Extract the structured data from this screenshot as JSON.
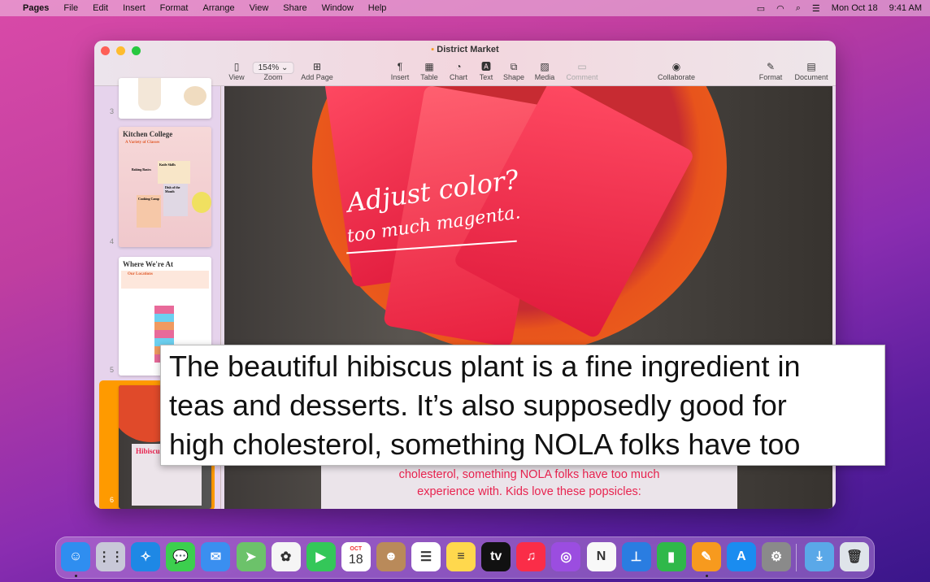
{
  "menubar": {
    "apple": "",
    "items": [
      "Pages",
      "File",
      "Edit",
      "Insert",
      "Format",
      "Arrange",
      "View",
      "Share",
      "Window",
      "Help"
    ],
    "date": "Mon Oct 18",
    "time": "9:41 AM"
  },
  "window": {
    "title": "District Market"
  },
  "toolbar": {
    "zoom_value": "154%",
    "items": [
      {
        "label": "View",
        "icon": "sidebar-icon",
        "glyph": "▯"
      },
      {
        "label": "Zoom",
        "icon": "zoom-select"
      },
      {
        "label": "Add Page",
        "icon": "add-page-icon",
        "glyph": "⊞"
      },
      {
        "label": "Insert",
        "icon": "pilcrow-icon",
        "glyph": "¶"
      },
      {
        "label": "Table",
        "icon": "table-icon",
        "glyph": "▦"
      },
      {
        "label": "Chart",
        "icon": "chart-icon",
        "glyph": "◔"
      },
      {
        "label": "Text",
        "icon": "text-icon",
        "glyph": "🅰"
      },
      {
        "label": "Shape",
        "icon": "shape-icon",
        "glyph": "⧉"
      },
      {
        "label": "Media",
        "icon": "media-icon",
        "glyph": "▨"
      },
      {
        "label": "Comment",
        "icon": "comment-icon",
        "glyph": "▭",
        "disabled": true
      },
      {
        "label": "Collaborate",
        "icon": "collaborate-icon",
        "glyph": "◉"
      },
      {
        "label": "Format",
        "icon": "format-brush-icon",
        "glyph": "✎"
      },
      {
        "label": "Document",
        "icon": "document-icon",
        "glyph": "▤"
      }
    ]
  },
  "sidebar": {
    "pages": [
      {
        "num": "3"
      },
      {
        "num": "4",
        "title": "Kitchen College",
        "subtitle": "A Variety of Classes",
        "boxes": [
          "Baking Basics",
          "Knife Skills",
          "Dish of the Month",
          "Cooking Camp"
        ]
      },
      {
        "num": "5",
        "title": "Where We're At",
        "subtitle": "Our Locations"
      },
      {
        "num": "6",
        "title": "Hibiscus",
        "selected": true
      }
    ]
  },
  "canvas": {
    "annotation_line1": "Adjust color?",
    "annotation_line2": "too much magenta.",
    "body_lines": [
      "cholesterol, something NOLA folks have too much",
      "experience with. Kids love these popsicles:"
    ],
    "text_color": "#e8234f"
  },
  "hover_text": {
    "lines": [
      "The beautiful hibiscus plant is a fine ingredient in",
      "teas and desserts. It’s also supposedly good for",
      "high cholesterol, something NOLA folks have too"
    ]
  },
  "dock": {
    "apps": [
      {
        "name": "Finder",
        "color": "#2f8ef0",
        "glyph": "☺",
        "running": true
      },
      {
        "name": "Launchpad",
        "color": "#c8c8d8",
        "glyph": "⋮⋮"
      },
      {
        "name": "Safari",
        "color": "#1e88e5",
        "glyph": "✧"
      },
      {
        "name": "Messages",
        "color": "#3ccf4e",
        "glyph": "💬"
      },
      {
        "name": "Mail",
        "color": "#3a8ff0",
        "glyph": "✉"
      },
      {
        "name": "Maps",
        "color": "#6cc26a",
        "glyph": "➤"
      },
      {
        "name": "Photos",
        "color": "#f5f5f5",
        "glyph": "✿"
      },
      {
        "name": "FaceTime",
        "color": "#34c759",
        "glyph": "▶"
      },
      {
        "name": "Calendar",
        "color": "#ffffff",
        "glyph": "18",
        "month": "OCT"
      },
      {
        "name": "Contacts",
        "color": "#b98a5a",
        "glyph": "☻"
      },
      {
        "name": "Reminders",
        "color": "#ffffff",
        "glyph": "☰"
      },
      {
        "name": "Notes",
        "color": "#ffd84d",
        "glyph": "≡"
      },
      {
        "name": "TV",
        "color": "#111111",
        "glyph": "tv"
      },
      {
        "name": "Music",
        "color": "#fa2d48",
        "glyph": "♫"
      },
      {
        "name": "Podcasts",
        "color": "#9b4de0",
        "glyph": "◎"
      },
      {
        "name": "News",
        "color": "#f8f8f8",
        "glyph": "N"
      },
      {
        "name": "Keynote",
        "color": "#2a7de1",
        "glyph": "⊥"
      },
      {
        "name": "Numbers",
        "color": "#2fb84a",
        "glyph": "▮"
      },
      {
        "name": "Pages",
        "color": "#f79a1e",
        "glyph": "✎",
        "running": true
      },
      {
        "name": "App Store",
        "color": "#1a8cf0",
        "glyph": "A"
      },
      {
        "name": "System Preferences",
        "color": "#8a8a8a",
        "glyph": "⚙"
      },
      {
        "name": "Downloads",
        "color": "#5aa8e8",
        "glyph": "⤓"
      },
      {
        "name": "Trash",
        "color": "#dfe4ea",
        "glyph": "🗑"
      }
    ]
  }
}
